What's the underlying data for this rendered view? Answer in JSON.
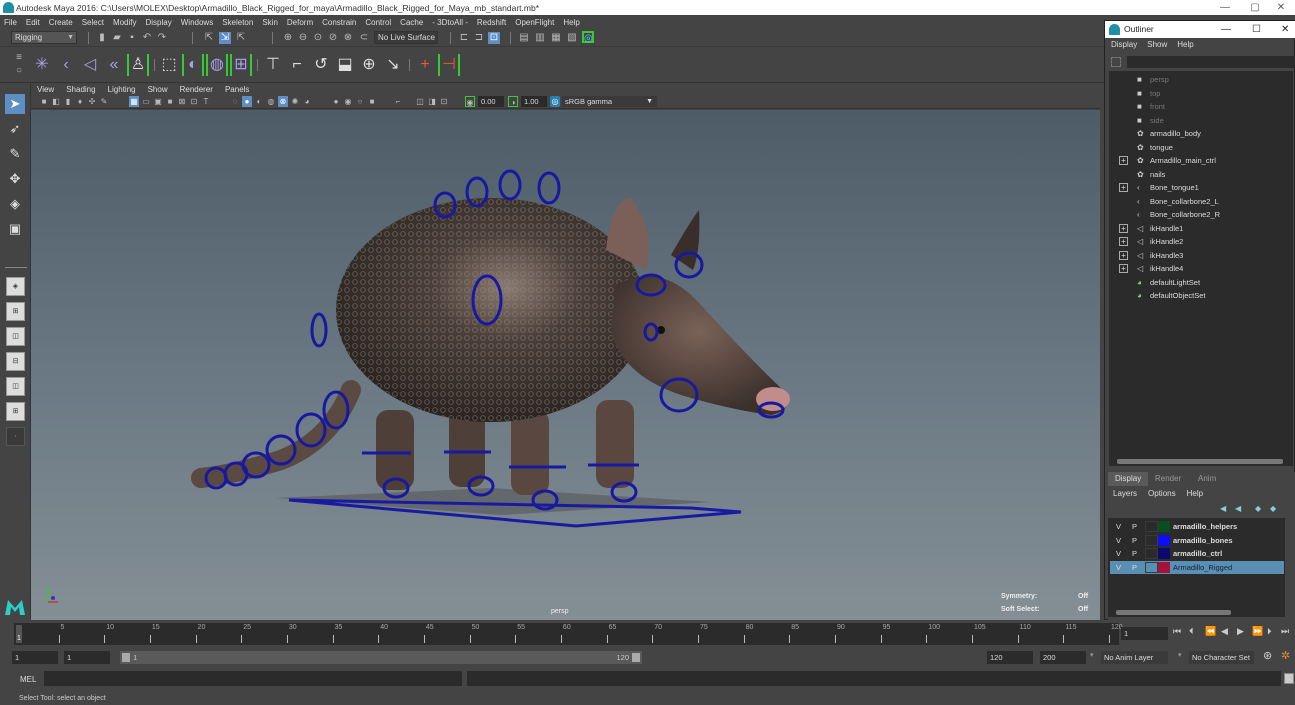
{
  "window": {
    "title": "Autodesk Maya 2016: C:\\Users\\MOLEX\\Desktop\\Armadillo_Black_Rigged_for_maya\\Armadillo_Black_Rigged_for_Maya_mb_standart.mb*",
    "minimize": "—",
    "maximize": "▢",
    "close": "✕"
  },
  "menubar": [
    "File",
    "Edit",
    "Create",
    "Select",
    "Modify",
    "Display",
    "Windows",
    "Skeleton",
    "Skin",
    "Deform",
    "Constrain",
    "Control",
    "Cache",
    "- 3DtoAll -",
    "Redshift",
    "OpenFlight",
    "Help"
  ],
  "status_line": {
    "menu_set": "Rigging",
    "live_surface": "No Live Surface"
  },
  "viewport": {
    "menu": [
      "View",
      "Shading",
      "Lighting",
      "Show",
      "Renderer",
      "Panels"
    ],
    "exposure": "0.00",
    "gamma": "1.00",
    "color_space": "sRGB gamma",
    "camera": "persp",
    "hud": [
      {
        "label": "Symmetry:",
        "value": "Off"
      },
      {
        "label": "Soft Select:",
        "value": "Off"
      }
    ]
  },
  "outliner": {
    "title": "Outliner",
    "menu": [
      "Display",
      "Show",
      "Help"
    ],
    "items": [
      {
        "label": "persp",
        "icon": "camera-icon",
        "expandable": false,
        "dim": true
      },
      {
        "label": "top",
        "icon": "camera-icon",
        "expandable": false,
        "dim": true
      },
      {
        "label": "front",
        "icon": "camera-icon",
        "expandable": false,
        "dim": true
      },
      {
        "label": "side",
        "icon": "camera-icon",
        "expandable": false,
        "dim": true
      },
      {
        "label": "armadillo_body",
        "icon": "mesh-icon",
        "expandable": false,
        "dim": false
      },
      {
        "label": "tongue",
        "icon": "mesh-icon",
        "expandable": false,
        "dim": false
      },
      {
        "label": "Armadillo_main_ctrl",
        "icon": "mesh-icon",
        "expandable": true,
        "dim": false
      },
      {
        "label": "nails",
        "icon": "mesh-icon",
        "expandable": false,
        "dim": false
      },
      {
        "label": "Bone_tongue1",
        "icon": "joint-icon",
        "expandable": true,
        "dim": false
      },
      {
        "label": "Bone_collarbone2_L",
        "icon": "joint-icon",
        "expandable": false,
        "dim": false
      },
      {
        "label": "Bone_collarbone2_R",
        "icon": "joint-icon",
        "expandable": false,
        "dim": false
      },
      {
        "label": "ikHandle1",
        "icon": "ik-handle-icon",
        "expandable": true,
        "dim": false
      },
      {
        "label": "ikHandle2",
        "icon": "ik-handle-icon",
        "expandable": true,
        "dim": false
      },
      {
        "label": "ikHandle3",
        "icon": "ik-handle-icon",
        "expandable": true,
        "dim": false
      },
      {
        "label": "ikHandle4",
        "icon": "ik-handle-icon",
        "expandable": true,
        "dim": false
      },
      {
        "label": "defaultLightSet",
        "icon": "set-icon",
        "expandable": false,
        "dim": false
      },
      {
        "label": "defaultObjectSet",
        "icon": "set-icon",
        "expandable": false,
        "dim": false
      }
    ]
  },
  "layer_editor": {
    "tabs": [
      "Display",
      "Render",
      "Anim"
    ],
    "active_tab": "Display",
    "menu": [
      "Layers",
      "Options",
      "Help"
    ],
    "layers": [
      {
        "v": "V",
        "p": "P",
        "name": "armadillo_helpers",
        "color": "#0b4d22",
        "selected": false
      },
      {
        "v": "V",
        "p": "P",
        "name": "armadillo_bones",
        "color": "#0b10f0",
        "selected": false
      },
      {
        "v": "V",
        "p": "P",
        "name": "armadillo_ctrl",
        "color": "#0a0a6e",
        "selected": false
      },
      {
        "v": "V",
        "p": "P",
        "name": "Armadillo_Rigged",
        "color": "#a3123a",
        "selected": true
      }
    ]
  },
  "timeline": {
    "ticks": [
      "5",
      "10",
      "15",
      "20",
      "25",
      "30",
      "35",
      "40",
      "45",
      "50",
      "55",
      "60",
      "65",
      "70",
      "75",
      "80",
      "85",
      "90",
      "95",
      "100",
      "105",
      "110",
      "115",
      "120"
    ],
    "current_frame_marker": "1",
    "current_frame": "1",
    "range_start": "1",
    "playback_start": "1",
    "slider_start": "1",
    "slider_end": "120",
    "playback_end": "120",
    "range_end": "200",
    "anim_layer": "No Anim Layer",
    "character_set": "No Character Set"
  },
  "command_line": {
    "label": "MEL",
    "status": "Select Tool: select an object"
  }
}
